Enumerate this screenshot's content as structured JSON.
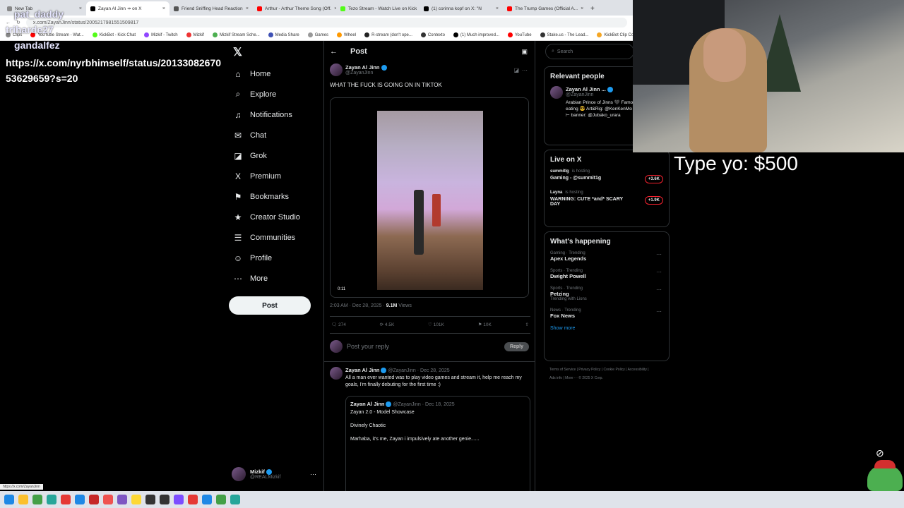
{
  "browser": {
    "tabs": [
      {
        "label": "New Tab",
        "color": "#888888"
      },
      {
        "label": "Zayan Al Jinn ↠ on X",
        "color": "#000000",
        "active": true
      },
      {
        "label": "Friend Sniffing Head Reaction",
        "color": "#555555"
      },
      {
        "label": "Arthur - Arthur Theme Song (Off.",
        "color": "#ff0000"
      },
      {
        "label": "Tezo Stream - Watch Live on Kick",
        "color": "#53fc18"
      },
      {
        "label": "(1) corinna kopf on X: \"N",
        "color": "#000000"
      },
      {
        "label": "The Trump Games (Official A...",
        "color": "#ff0000"
      }
    ],
    "url": "x.com/ZayanJinn/status/2005217981551509817",
    "bookmarks": [
      "Clips",
      "YouTube Stream - Wat...",
      "KickBot - Kick Chat",
      "Mizkif - Twitch",
      "Mizkif",
      "Mizkif Stream Sche...",
      "Media Share",
      "Games",
      "Wheel",
      "R-stream (don't ope...",
      "Contexto",
      "(1) Much improved...",
      "YouTube",
      "Stake.us - The Lead...",
      "KickBot Clip Comm..."
    ]
  },
  "chat": {
    "users": [
      "pat_daddy",
      "triharde27",
      "gandalfez"
    ],
    "message_line1": "https://x.com/nyrbhimself/status/20133082670",
    "message_line2": "53629659?s=20",
    "overlay_text": "Type yo: $500"
  },
  "nav": {
    "items": [
      {
        "icon": "home-icon",
        "glyph": "⌂",
        "label": "Home"
      },
      {
        "icon": "explore-icon",
        "glyph": "⌕",
        "label": "Explore"
      },
      {
        "icon": "notifications-icon",
        "glyph": "♫",
        "label": "Notifications"
      },
      {
        "icon": "chat-icon",
        "glyph": "✉",
        "label": "Chat"
      },
      {
        "icon": "grok-icon",
        "glyph": "◪",
        "label": "Grok"
      },
      {
        "icon": "premium-icon",
        "glyph": "X",
        "label": "Premium"
      },
      {
        "icon": "bookmarks-icon",
        "glyph": "⚑",
        "label": "Bookmarks"
      },
      {
        "icon": "creator-studio-icon",
        "glyph": "★",
        "label": "Creator Studio"
      },
      {
        "icon": "communities-icon",
        "glyph": "☰",
        "label": "Communities"
      },
      {
        "icon": "profile-icon",
        "glyph": "☺",
        "label": "Profile"
      },
      {
        "icon": "more-icon",
        "glyph": "⋯",
        "label": "More"
      }
    ],
    "post_button": "Post",
    "account_name": "Mizkif",
    "account_handle": "@REALMizkif"
  },
  "post": {
    "header": "Post",
    "author_name": "Zayan Al Jinn",
    "author_handle": "@ZayanJinn",
    "text": "WHAT THE FUCK IS GOING ON IN TIKTOK",
    "video_time": "0:11",
    "timestamp": "2:03 AM · Dec 28, 2025 · ",
    "views_count": "9.1M",
    "views_label": " Views",
    "replies": "274",
    "reposts": "4.5K",
    "likes": "101K",
    "bookmarks": "10K",
    "reply_placeholder": "Post your reply",
    "reply_button": "Reply"
  },
  "reply": {
    "author_name": "Zayan Al Jinn",
    "meta": "@ZayanJinn · Dec 28, 2025",
    "text": "All a man ever wanted was to play video games and stream it, help me reach my goals, I'm finally debuting for the first time :)",
    "quote_author": "Zayan Al Jinn",
    "quote_meta": "@ZayanJinn · Dec 18, 2025",
    "quote_line1": "Zayan 2.0 - Model Showcase",
    "quote_line2": "Divinely Chaotic",
    "quote_line3": "Marhaba, it's me, Zayan i impulsively ate another genie......"
  },
  "right": {
    "search_placeholder": "Search",
    "relevant_title": "Relevant people",
    "relevant_name": "Zayan Al Jinn ...",
    "relevant_handle": "@ZayanJinn",
    "relevant_bio": "Arabian Prince of Jinns 🖤 Famously known for eating 😎 Art&Rig: @KenKenMo @mnt_kaedl ⊢ banner: @Jubako_urara",
    "live_title": "Live on X",
    "live": [
      {
        "host": "summitlg",
        "hosting": "is hosting",
        "title": "Gaming - @summit1g",
        "count": "+3.6K"
      },
      {
        "host": "Layna",
        "hosting": "is hosting",
        "title": "WARNING: CUTE *and* SCARY DAY",
        "count": "+1.9K"
      }
    ],
    "happening_title": "What's happening",
    "trends": [
      {
        "cat": "Gaming · Trending",
        "title": "Apex Legends",
        "extra": ""
      },
      {
        "cat": "Sports · Trending",
        "title": "Dwight Powell",
        "extra": ""
      },
      {
        "cat": "Sports · Trending",
        "title": "Petzing",
        "extra": "Trending with Lions"
      },
      {
        "cat": "News · Trending",
        "title": "Fox News",
        "extra": ""
      }
    ],
    "show_more": "Show more",
    "footer": "Terms of Service  |  Privacy Policy  |  Cookie Policy  |  Accessibility  |  Ads info  |  More ···  © 2025 X Corp."
  },
  "status_url": "https://x.com/ZayanJinn"
}
